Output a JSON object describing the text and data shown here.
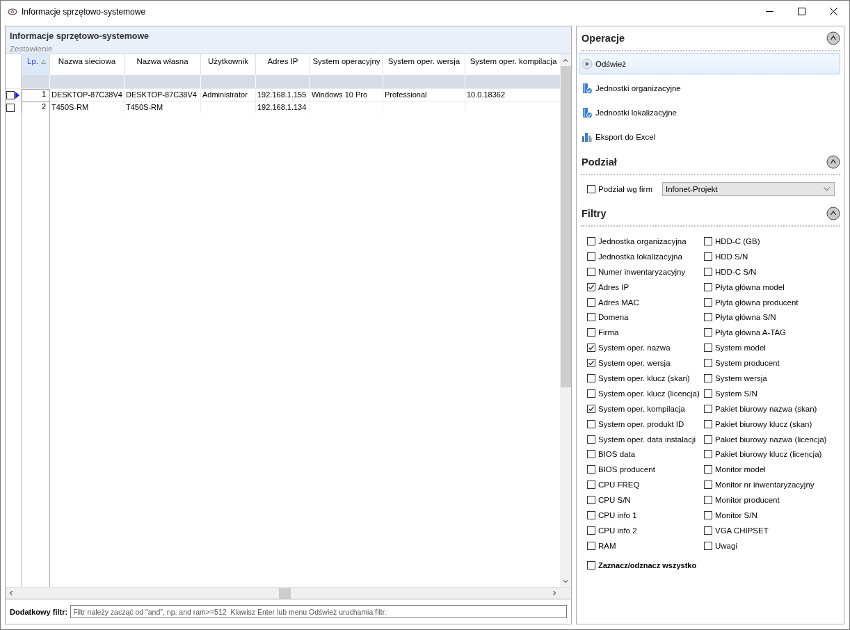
{
  "window": {
    "title": "Informacje sprzętowo-systemowe"
  },
  "panel": {
    "title": "Informacje sprzętowo-systemowe",
    "subtitle": "Zestawienie"
  },
  "table": {
    "columns": [
      {
        "label": "Lp.",
        "sorted": true
      },
      {
        "label": "Nazwa sieciowa",
        "sorted": false
      },
      {
        "label": "Nazwa własna",
        "sorted": false
      },
      {
        "label": "Użytkownik",
        "sorted": false
      },
      {
        "label": "Adres IP",
        "sorted": false
      },
      {
        "label": "System operacyjny",
        "sorted": false
      },
      {
        "label": "System oper. wersja",
        "sorted": false
      },
      {
        "label": "System oper. kompilacja",
        "sorted": false
      }
    ],
    "rows": [
      {
        "checked": false,
        "current": true,
        "cells": [
          "1",
          "DESKTOP-87C38V4",
          "DESKTOP-87C38V4",
          "Administrator",
          "192.168.1.155",
          "Windows 10 Pro",
          "Professional",
          "10.0.18362"
        ]
      },
      {
        "checked": false,
        "current": false,
        "cells": [
          "2",
          "T450S-RM",
          "T450S-RM",
          "",
          "192.168.1.134",
          "",
          "",
          ""
        ]
      }
    ]
  },
  "extra_filter": {
    "label": "Dodatkowy filtr:",
    "placeholder": "Filtr należy zacząć od \"and\", np. and ram>=512  Klawisz Enter lub menu Odśwież uruchamia filtr."
  },
  "operations": {
    "title": "Operacje",
    "expanded": true,
    "items": [
      {
        "label": "Odśwież",
        "kind": "play",
        "selected": true
      },
      {
        "label": "Jednostki organizacyjne",
        "kind": "units",
        "selected": false
      },
      {
        "label": "Jednostki lokalizacyjne",
        "kind": "units",
        "selected": false
      },
      {
        "label": "Eksport do Excel",
        "kind": "export",
        "selected": false
      }
    ]
  },
  "split": {
    "title": "Podział",
    "expanded": true,
    "checkbox": {
      "label": "Podział wg firm",
      "checked": false
    },
    "dropdown": {
      "value": "Infonet-Projekt"
    }
  },
  "filters": {
    "title": "Filtry",
    "expanded": true,
    "column_1": [
      {
        "label": "Jednostka organizacyjna",
        "checked": false
      },
      {
        "label": "Jednostka lokalizacyjna",
        "checked": false
      },
      {
        "label": "Numer inwentaryzacyjny",
        "checked": false
      },
      {
        "label": "Adres IP",
        "checked": true
      },
      {
        "label": "Adres MAC",
        "checked": false
      },
      {
        "label": "Domena",
        "checked": false
      },
      {
        "label": "Firma",
        "checked": false
      },
      {
        "label": "System oper. nazwa",
        "checked": true
      },
      {
        "label": "System oper. wersja",
        "checked": true
      },
      {
        "label": "System oper. klucz (skan)",
        "checked": false
      },
      {
        "label": "System oper. klucz (licencja)",
        "checked": false
      },
      {
        "label": "System oper. kompilacja",
        "checked": true
      },
      {
        "label": "System oper. produkt ID",
        "checked": false
      },
      {
        "label": "System oper. data instalacji",
        "checked": false
      },
      {
        "label": "BIOS data",
        "checked": false
      },
      {
        "label": "BIOS producent",
        "checked": false
      },
      {
        "label": "CPU FREQ",
        "checked": false
      },
      {
        "label": "CPU S/N",
        "checked": false
      },
      {
        "label": "CPU info 1",
        "checked": false
      },
      {
        "label": "CPU info 2",
        "checked": false
      },
      {
        "label": "RAM",
        "checked": false
      }
    ],
    "column_2": [
      {
        "label": "HDD-C (GB)",
        "checked": false
      },
      {
        "label": "HDD S/N",
        "checked": false
      },
      {
        "label": "HDD-C S/N",
        "checked": false
      },
      {
        "label": "Płyta główna model",
        "checked": false
      },
      {
        "label": "Płyta główna producent",
        "checked": false
      },
      {
        "label": "Płyta główna S/N",
        "checked": false
      },
      {
        "label": "Płyta główna A-TAG",
        "checked": false
      },
      {
        "label": "System model",
        "checked": false
      },
      {
        "label": "System producent",
        "checked": false
      },
      {
        "label": "System wersja",
        "checked": false
      },
      {
        "label": "System S/N",
        "checked": false
      },
      {
        "label": "Pakiet biurowy nazwa (skan)",
        "checked": false
      },
      {
        "label": "Pakiet biurowy klucz (skan)",
        "checked": false
      },
      {
        "label": "Pakiet biurowy nazwa (licencja)",
        "checked": false
      },
      {
        "label": "Pakiet biurowy klucz (licencja)",
        "checked": false
      },
      {
        "label": "Monitor model",
        "checked": false
      },
      {
        "label": "Monitor nr inwentaryzacyjny",
        "checked": false
      },
      {
        "label": "Monitor producent",
        "checked": false
      },
      {
        "label": "Monitor S/N",
        "checked": false
      },
      {
        "label": "VGA CHIPSET",
        "checked": false
      },
      {
        "label": "Uwagi",
        "checked": false
      }
    ],
    "select_all": {
      "label": "Zaznacz/odznacz wszystko",
      "checked": false
    }
  }
}
